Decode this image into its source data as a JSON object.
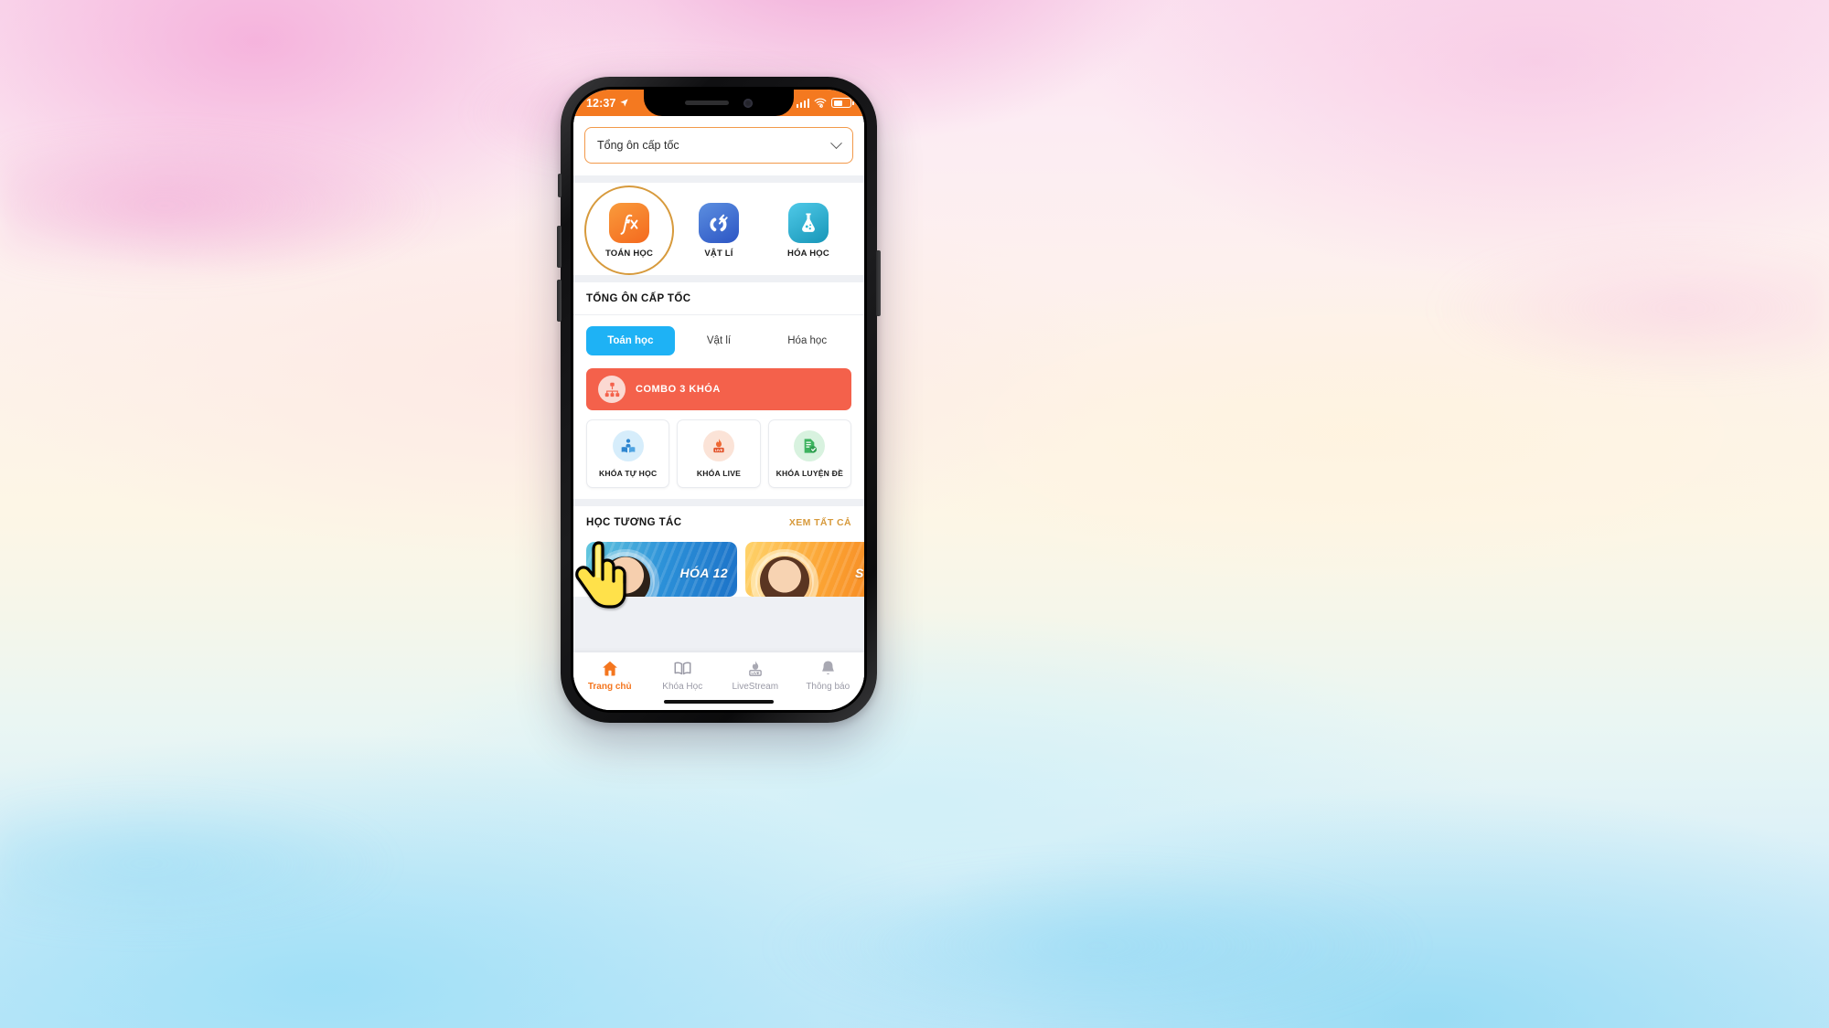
{
  "status_bar": {
    "time": "12:37",
    "location_icon": "location-arrow-icon",
    "signal_icon": "cellular-bars-icon",
    "wifi_icon": "wifi-icon",
    "battery_icon": "battery-icon"
  },
  "dropdown": {
    "value": "Tổng ôn cấp tốc",
    "chevron_icon": "chevron-down-icon"
  },
  "subjects": [
    {
      "label": "TOÁN HỌC",
      "icon": "function-fx-icon",
      "selected": true
    },
    {
      "label": "VẬT LÍ",
      "icon": "magnet-icon",
      "selected": false
    },
    {
      "label": "HÓA HỌC",
      "icon": "flask-icon",
      "selected": false
    }
  ],
  "section_ton_on": {
    "title": "TỔNG ÔN CẤP TỐC",
    "tabs": [
      {
        "label": "Toán học",
        "active": true
      },
      {
        "label": "Vật lí",
        "active": false
      },
      {
        "label": "Hóa học",
        "active": false
      }
    ],
    "combo": {
      "label": "COMBO 3 KHÓA",
      "icon": "org-chart-icon",
      "color": "#F4614B"
    },
    "course_types": [
      {
        "label": "KHÓA TỰ HỌC",
        "icon": "reading-person-icon"
      },
      {
        "label": "KHÓA LIVE",
        "icon": "live-flame-icon"
      },
      {
        "label": "KHÓA LUYỆN ĐỀ",
        "icon": "document-check-icon"
      }
    ]
  },
  "section_interactive": {
    "title": "HỌC TƯƠNG TÁC",
    "see_all": "XEM TẤT CẢ",
    "cards": [
      {
        "title": "HÓA 12",
        "theme": "blue"
      },
      {
        "title": "SINH",
        "theme": "orange"
      }
    ]
  },
  "bottom_nav": [
    {
      "label": "Trang chủ",
      "icon": "home-icon",
      "active": true
    },
    {
      "label": "Khóa Học",
      "icon": "book-icon",
      "active": false
    },
    {
      "label": "LiveStream",
      "icon": "live-flame-icon",
      "active": false
    },
    {
      "label": "Thông báo",
      "icon": "bell-icon",
      "active": false
    }
  ],
  "cursor": {
    "icon": "hand-pointer-cursor"
  },
  "colors": {
    "brand_orange": "#F47920",
    "tab_blue": "#1EB2F5",
    "combo_red": "#F4614B",
    "link_gold": "#D79A3C"
  }
}
